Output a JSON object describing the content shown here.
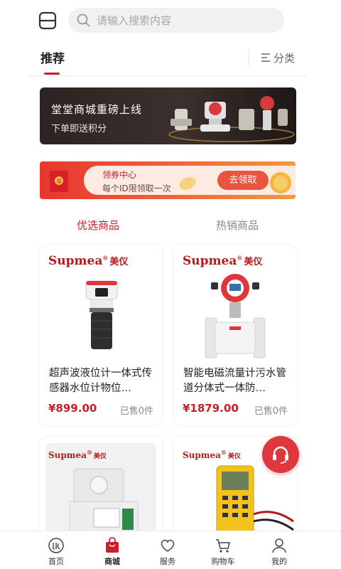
{
  "search": {
    "placeholder": "请输入搜索内容"
  },
  "tabs": {
    "recommend": "推荐",
    "category": "分类"
  },
  "banner": {
    "title": "堂堂商城重磅上线",
    "subtitle": "下单即送积分"
  },
  "coupon": {
    "title": "领券中心",
    "desc": "每个ID限领取一次",
    "button": "去领取"
  },
  "sub_tabs": {
    "selected": "优选商品",
    "hot": "热销商品"
  },
  "products": [
    {
      "brand": "Supmea",
      "brand_cn": "美仪",
      "name": "超声波液位计一体式传感器水位计物位…",
      "price": "¥899.00",
      "sold": "已售0件"
    },
    {
      "brand": "Supmea",
      "brand_cn": "美仪",
      "name": "智能电磁流量计污水管道分体式一体防…",
      "price": "¥1879.00",
      "sold": "已售0件"
    },
    {
      "brand": "Supmea",
      "brand_cn": "美仪"
    },
    {
      "brand": "Supmea",
      "brand_cn": "美仪"
    }
  ],
  "tabbar": [
    {
      "label": "首页",
      "icon": "home-icon"
    },
    {
      "label": "商城",
      "icon": "shop-bag-icon",
      "active": true
    },
    {
      "label": "服务",
      "icon": "heart-icon"
    },
    {
      "label": "购物车",
      "icon": "cart-icon"
    },
    {
      "label": "我的",
      "icon": "user-icon"
    }
  ],
  "colors": {
    "accent": "#c8202b",
    "fab": "#e0373f"
  }
}
